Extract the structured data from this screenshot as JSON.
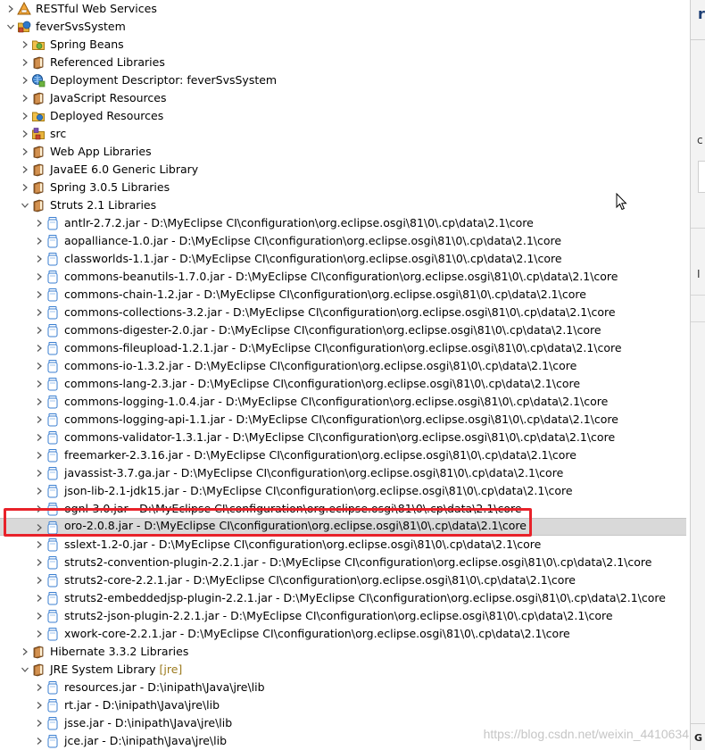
{
  "colors": {
    "selection": "#d9d9d9",
    "highlight_box": "#e8222a",
    "jre_decoration": "#9b7a1e"
  },
  "tree": [
    {
      "label": "RESTful Web Services",
      "path": "",
      "decoration": "",
      "indent": 0,
      "expanded": false,
      "icon": "rest-services-icon",
      "selected": false
    },
    {
      "label": "feverSvsSystem",
      "path": "",
      "decoration": "",
      "indent": 0,
      "expanded": true,
      "icon": "web-project-icon",
      "selected": false
    },
    {
      "label": "Spring Beans",
      "path": "",
      "decoration": "",
      "indent": 1,
      "expanded": false,
      "icon": "spring-beans-icon",
      "selected": false
    },
    {
      "label": "Referenced Libraries",
      "path": "",
      "decoration": "",
      "indent": 1,
      "expanded": false,
      "icon": "library-icon",
      "selected": false
    },
    {
      "label": "Deployment Descriptor: feverSvsSystem",
      "path": "",
      "decoration": "",
      "indent": 1,
      "expanded": false,
      "icon": "deployment-descriptor-icon",
      "selected": false
    },
    {
      "label": "JavaScript Resources",
      "path": "",
      "decoration": "",
      "indent": 1,
      "expanded": false,
      "icon": "library-icon",
      "selected": false
    },
    {
      "label": "Deployed Resources",
      "path": "",
      "decoration": "",
      "indent": 1,
      "expanded": false,
      "icon": "deployed-resources-icon",
      "selected": false
    },
    {
      "label": "src",
      "path": "",
      "decoration": "",
      "indent": 1,
      "expanded": false,
      "icon": "source-folder-icon",
      "selected": false
    },
    {
      "label": "Web App Libraries",
      "path": "",
      "decoration": "",
      "indent": 1,
      "expanded": false,
      "icon": "library-icon",
      "selected": false
    },
    {
      "label": "JavaEE 6.0 Generic Library",
      "path": "",
      "decoration": "",
      "indent": 1,
      "expanded": false,
      "icon": "library-icon",
      "selected": false
    },
    {
      "label": "Spring 3.0.5 Libraries",
      "path": "",
      "decoration": "",
      "indent": 1,
      "expanded": false,
      "icon": "library-icon",
      "selected": false
    },
    {
      "label": "Struts 2.1 Libraries",
      "path": "",
      "decoration": "",
      "indent": 1,
      "expanded": true,
      "icon": "library-icon",
      "selected": false
    },
    {
      "label": "antlr-2.7.2.jar",
      "path": " - D:\\MyEclipse CI\\configuration\\org.eclipse.osgi\\81\\0\\.cp\\data\\2.1\\core",
      "decoration": "",
      "indent": 2,
      "expanded": false,
      "icon": "jar-icon",
      "selected": false
    },
    {
      "label": "aopalliance-1.0.jar",
      "path": " - D:\\MyEclipse CI\\configuration\\org.eclipse.osgi\\81\\0\\.cp\\data\\2.1\\core",
      "decoration": "",
      "indent": 2,
      "expanded": false,
      "icon": "jar-icon",
      "selected": false
    },
    {
      "label": "classworlds-1.1.jar",
      "path": " - D:\\MyEclipse CI\\configuration\\org.eclipse.osgi\\81\\0\\.cp\\data\\2.1\\core",
      "decoration": "",
      "indent": 2,
      "expanded": false,
      "icon": "jar-icon",
      "selected": false
    },
    {
      "label": "commons-beanutils-1.7.0.jar",
      "path": " - D:\\MyEclipse CI\\configuration\\org.eclipse.osgi\\81\\0\\.cp\\data\\2.1\\core",
      "decoration": "",
      "indent": 2,
      "expanded": false,
      "icon": "jar-icon",
      "selected": false
    },
    {
      "label": "commons-chain-1.2.jar",
      "path": " - D:\\MyEclipse CI\\configuration\\org.eclipse.osgi\\81\\0\\.cp\\data\\2.1\\core",
      "decoration": "",
      "indent": 2,
      "expanded": false,
      "icon": "jar-icon",
      "selected": false
    },
    {
      "label": "commons-collections-3.2.jar",
      "path": " - D:\\MyEclipse CI\\configuration\\org.eclipse.osgi\\81\\0\\.cp\\data\\2.1\\core",
      "decoration": "",
      "indent": 2,
      "expanded": false,
      "icon": "jar-icon",
      "selected": false
    },
    {
      "label": "commons-digester-2.0.jar",
      "path": " - D:\\MyEclipse CI\\configuration\\org.eclipse.osgi\\81\\0\\.cp\\data\\2.1\\core",
      "decoration": "",
      "indent": 2,
      "expanded": false,
      "icon": "jar-icon",
      "selected": false
    },
    {
      "label": "commons-fileupload-1.2.1.jar",
      "path": " - D:\\MyEclipse CI\\configuration\\org.eclipse.osgi\\81\\0\\.cp\\data\\2.1\\core",
      "decoration": "",
      "indent": 2,
      "expanded": false,
      "icon": "jar-icon",
      "selected": false
    },
    {
      "label": "commons-io-1.3.2.jar",
      "path": " - D:\\MyEclipse CI\\configuration\\org.eclipse.osgi\\81\\0\\.cp\\data\\2.1\\core",
      "decoration": "",
      "indent": 2,
      "expanded": false,
      "icon": "jar-icon",
      "selected": false
    },
    {
      "label": "commons-lang-2.3.jar",
      "path": " - D:\\MyEclipse CI\\configuration\\org.eclipse.osgi\\81\\0\\.cp\\data\\2.1\\core",
      "decoration": "",
      "indent": 2,
      "expanded": false,
      "icon": "jar-icon",
      "selected": false
    },
    {
      "label": "commons-logging-1.0.4.jar",
      "path": " - D:\\MyEclipse CI\\configuration\\org.eclipse.osgi\\81\\0\\.cp\\data\\2.1\\core",
      "decoration": "",
      "indent": 2,
      "expanded": false,
      "icon": "jar-icon",
      "selected": false
    },
    {
      "label": "commons-logging-api-1.1.jar",
      "path": " - D:\\MyEclipse CI\\configuration\\org.eclipse.osgi\\81\\0\\.cp\\data\\2.1\\core",
      "decoration": "",
      "indent": 2,
      "expanded": false,
      "icon": "jar-icon",
      "selected": false
    },
    {
      "label": "commons-validator-1.3.1.jar",
      "path": " - D:\\MyEclipse CI\\configuration\\org.eclipse.osgi\\81\\0\\.cp\\data\\2.1\\core",
      "decoration": "",
      "indent": 2,
      "expanded": false,
      "icon": "jar-icon",
      "selected": false
    },
    {
      "label": "freemarker-2.3.16.jar",
      "path": " - D:\\MyEclipse CI\\configuration\\org.eclipse.osgi\\81\\0\\.cp\\data\\2.1\\core",
      "decoration": "",
      "indent": 2,
      "expanded": false,
      "icon": "jar-icon",
      "selected": false
    },
    {
      "label": "javassist-3.7.ga.jar",
      "path": " - D:\\MyEclipse CI\\configuration\\org.eclipse.osgi\\81\\0\\.cp\\data\\2.1\\core",
      "decoration": "",
      "indent": 2,
      "expanded": false,
      "icon": "jar-icon",
      "selected": false
    },
    {
      "label": "json-lib-2.1-jdk15.jar",
      "path": " - D:\\MyEclipse CI\\configuration\\org.eclipse.osgi\\81\\0\\.cp\\data\\2.1\\core",
      "decoration": "",
      "indent": 2,
      "expanded": false,
      "icon": "jar-icon",
      "selected": false
    },
    {
      "label": "ognl-3.0.jar",
      "path": " - D:\\MyEclipse CI\\configuration\\org.eclipse.osgi\\81\\0\\.cp\\data\\2.1\\core",
      "decoration": "",
      "indent": 2,
      "expanded": false,
      "icon": "jar-icon",
      "selected": false
    },
    {
      "label": "oro-2.0.8.jar",
      "path": " - D:\\MyEclipse CI\\configuration\\org.eclipse.osgi\\81\\0\\.cp\\data\\2.1\\core",
      "decoration": "",
      "indent": 2,
      "expanded": false,
      "icon": "jar-icon",
      "selected": true
    },
    {
      "label": "sslext-1.2-0.jar",
      "path": " - D:\\MyEclipse CI\\configuration\\org.eclipse.osgi\\81\\0\\.cp\\data\\2.1\\core",
      "decoration": "",
      "indent": 2,
      "expanded": false,
      "icon": "jar-icon",
      "selected": false
    },
    {
      "label": "struts2-convention-plugin-2.2.1.jar",
      "path": " - D:\\MyEclipse CI\\configuration\\org.eclipse.osgi\\81\\0\\.cp\\data\\2.1\\core",
      "decoration": "",
      "indent": 2,
      "expanded": false,
      "icon": "jar-icon",
      "selected": false
    },
    {
      "label": "struts2-core-2.2.1.jar",
      "path": " - D:\\MyEclipse CI\\configuration\\org.eclipse.osgi\\81\\0\\.cp\\data\\2.1\\core",
      "decoration": "",
      "indent": 2,
      "expanded": false,
      "icon": "jar-icon",
      "selected": false
    },
    {
      "label": "struts2-embeddedjsp-plugin-2.2.1.jar",
      "path": " - D:\\MyEclipse CI\\configuration\\org.eclipse.osgi\\81\\0\\.cp\\data\\2.1\\core",
      "decoration": "",
      "indent": 2,
      "expanded": false,
      "icon": "jar-icon",
      "selected": false
    },
    {
      "label": "struts2-json-plugin-2.2.1.jar",
      "path": " - D:\\MyEclipse CI\\configuration\\org.eclipse.osgi\\81\\0\\.cp\\data\\2.1\\core",
      "decoration": "",
      "indent": 2,
      "expanded": false,
      "icon": "jar-icon",
      "selected": false
    },
    {
      "label": "xwork-core-2.2.1.jar",
      "path": " - D:\\MyEclipse CI\\configuration\\org.eclipse.osgi\\81\\0\\.cp\\data\\2.1\\core",
      "decoration": "",
      "indent": 2,
      "expanded": false,
      "icon": "jar-icon",
      "selected": false
    },
    {
      "label": "Hibernate 3.3.2 Libraries",
      "path": "",
      "decoration": "",
      "indent": 1,
      "expanded": false,
      "icon": "library-icon",
      "selected": false
    },
    {
      "label": "JRE System Library",
      "path": "",
      "decoration": " [jre]",
      "indent": 1,
      "expanded": true,
      "icon": "library-icon",
      "selected": false
    },
    {
      "label": "resources.jar",
      "path": " - D:\\inipath\\Java\\jre\\lib",
      "decoration": "",
      "indent": 2,
      "expanded": false,
      "icon": "jar-icon",
      "selected": false
    },
    {
      "label": "rt.jar",
      "path": " - D:\\inipath\\Java\\jre\\lib",
      "decoration": "",
      "indent": 2,
      "expanded": false,
      "icon": "jar-icon",
      "selected": false
    },
    {
      "label": "jsse.jar",
      "path": " - D:\\inipath\\Java\\jre\\lib",
      "decoration": "",
      "indent": 2,
      "expanded": false,
      "icon": "jar-icon",
      "selected": false
    },
    {
      "label": "jce.jar",
      "path": " - D:\\inipath\\Java\\jre\\lib",
      "decoration": "",
      "indent": 2,
      "expanded": false,
      "icon": "jar-icon",
      "selected": false
    }
  ],
  "right_panel": {
    "glyph_top": "r",
    "glyph_mid": "c",
    "glyph_low": "I",
    "glyph_bottom": "G"
  },
  "watermark": "https://blog.csdn.net/weixin_4410634"
}
